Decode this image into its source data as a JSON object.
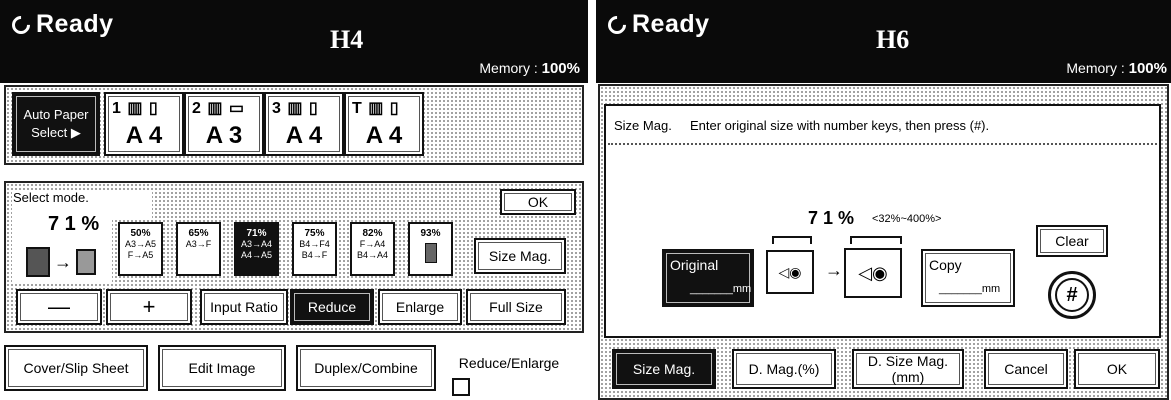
{
  "h4": {
    "status": "Ready",
    "panel_label": "H4",
    "memory_label": "Memory :",
    "memory_value": "100%",
    "auto_paper": {
      "line1": "Auto Paper",
      "line2": "Select ▶"
    },
    "trays": [
      {
        "tray": "1",
        "size": "A 4"
      },
      {
        "tray": "2",
        "size": "A 3"
      },
      {
        "tray": "3",
        "size": "A 4"
      },
      {
        "tray": "T",
        "size": "A 4"
      }
    ],
    "select_mode": "Select mode.",
    "ratio_display": "7 1 %",
    "ok": "OK",
    "presets": [
      {
        "pct": "50%",
        "l1": "A3→A5",
        "l2": "F→A5"
      },
      {
        "pct": "65%",
        "l1": "A3→F",
        "l2": ""
      },
      {
        "pct": "71%",
        "l1": "A3→A4",
        "l2": "A4→A5"
      },
      {
        "pct": "75%",
        "l1": "B4→F4",
        "l2": "B4→F"
      },
      {
        "pct": "82%",
        "l1": "F→A4",
        "l2": "B4→A4"
      },
      {
        "pct": "93%",
        "l1": "",
        "l2": ""
      }
    ],
    "size_mag": "Size Mag.",
    "minus": "—",
    "plus": "+",
    "input_ratio": "Input Ratio",
    "reduce": "Reduce",
    "enlarge": "Enlarge",
    "full_size": "Full Size",
    "tabs": [
      "Cover/Slip Sheet",
      "Edit Image",
      "Duplex/Combine",
      "Reduce/Enlarge"
    ]
  },
  "h6": {
    "status": "Ready",
    "panel_label": "H6",
    "memory_label": "Memory :",
    "memory_value": "100%",
    "title": "Size Mag.",
    "instruction": "Enter original size with number keys, then press (#).",
    "ratio_display": "7 1 %",
    "ratio_range": "<32%~400%>",
    "original_label": "Original",
    "original_unit": "mm",
    "copy_label": "Copy",
    "copy_unit": "mm",
    "clear": "Clear",
    "hash": "#",
    "tabs": [
      "Size Mag.",
      "D. Mag.(%)",
      "D. Size Mag.(mm)"
    ],
    "cancel": "Cancel",
    "ok": "OK"
  }
}
